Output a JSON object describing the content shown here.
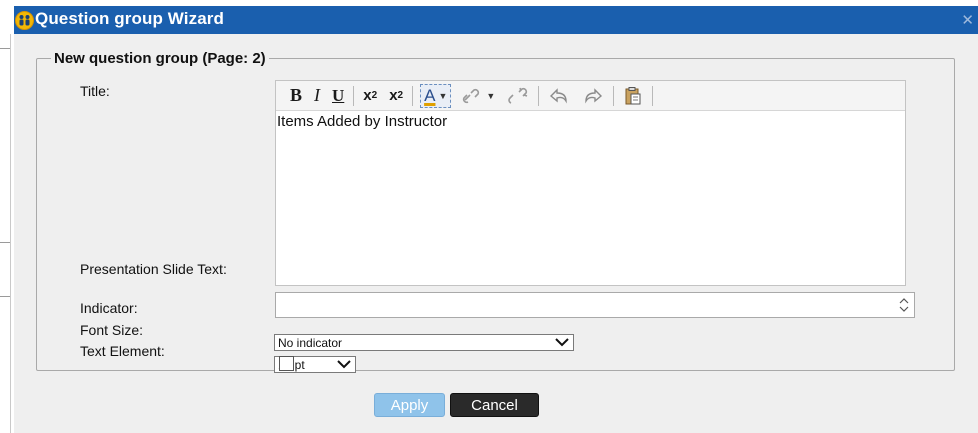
{
  "dialog": {
    "title": "Question group Wizard",
    "close_icon": "close-icon",
    "logo_icon": "people-logo-icon"
  },
  "group": {
    "legend": "New question group (Page: 2)"
  },
  "form": {
    "title_label": "Title:",
    "editor_text": "Items Added by Instructor",
    "slide_label": "Presentation Slide Text:",
    "slide_value": "",
    "indicator_label": "Indicator:",
    "indicator_value": "No indicator",
    "fontsize_label": "Font Size:",
    "fontsize_value": "10 pt",
    "text_element_label": "Text Element:",
    "text_element_checked": false
  },
  "toolbar": {
    "bold": "B",
    "italic": "I",
    "underline": "U",
    "subscript": "x",
    "subscript_mark": "2",
    "superscript": "x",
    "superscript_mark": "2",
    "font_color": "A",
    "tools": [
      "bold",
      "italic",
      "underline",
      "subscript",
      "superscript",
      "font-color",
      "link",
      "unlink",
      "undo",
      "redo",
      "paste"
    ]
  },
  "buttons": {
    "apply": "Apply",
    "cancel": "Cancel"
  },
  "colors": {
    "titlebar": "#1a5fae",
    "body": "#efefef",
    "apply": "#8fc3ea",
    "cancel": "#2a2a2a"
  }
}
